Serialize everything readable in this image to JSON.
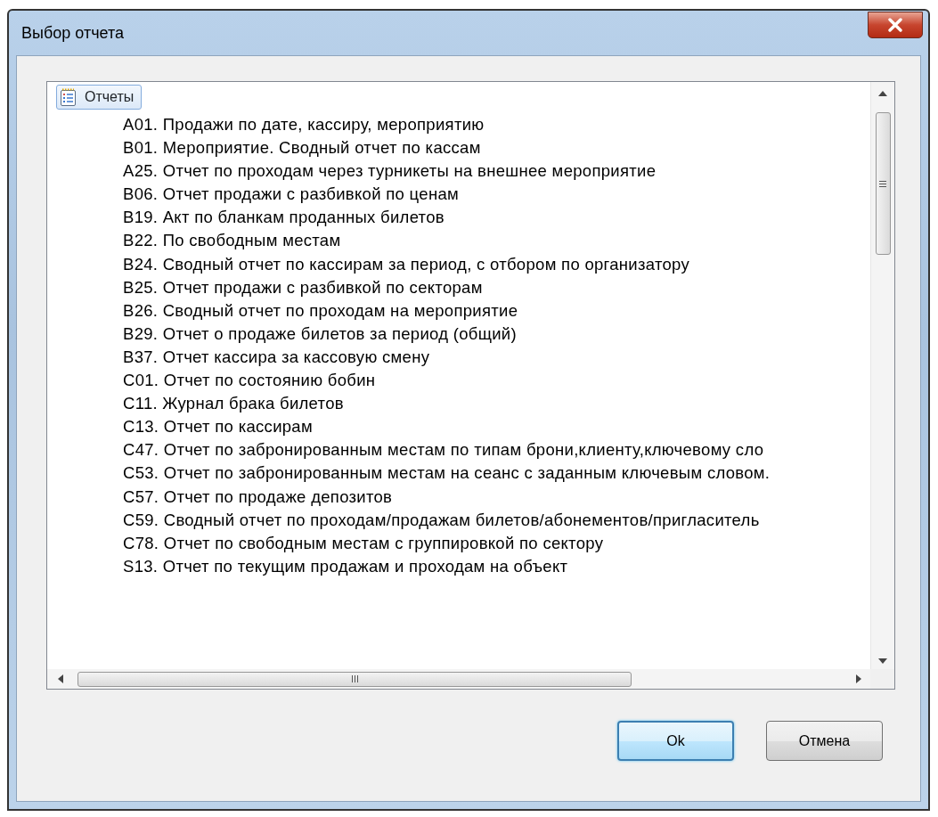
{
  "window": {
    "title": "Выбор отчета"
  },
  "tree": {
    "root": {
      "label": "Отчеты",
      "selected": true,
      "children": [
        {
          "label": "A01. Продажи по дате, кассиру, мероприятию",
          "selected": false
        },
        {
          "label": "B01. Мероприятие. Сводный отчет по кассам",
          "selected": false
        },
        {
          "label": "A25. Отчет по проходам через турникеты на внешнее мероприятие",
          "selected": false
        },
        {
          "label": "B06. Отчет продажи с разбивкой по ценам",
          "selected": false
        },
        {
          "label": "B19. Акт по бланкам проданных билетов",
          "selected": false
        },
        {
          "label": "B22. По свободным местам",
          "selected": false
        },
        {
          "label": "B24. Сводный отчет по кассирам за период, с отбором по организатору",
          "selected": false
        },
        {
          "label": "B25. Отчет продажи с разбивкой по секторам",
          "selected": false
        },
        {
          "label": "B26. Сводный отчет по проходам на мероприятие",
          "selected": false
        },
        {
          "label": "B29. Отчет о продаже билетов за период (общий)",
          "selected": false
        },
        {
          "label": "B37. Отчет кассира за кассовую смену",
          "selected": false
        },
        {
          "label": "C01. Отчет по состоянию бобин",
          "selected": false
        },
        {
          "label": "C11. Журнал брака билетов",
          "selected": false
        },
        {
          "label": "C13. Отчет по кассирам",
          "selected": false
        },
        {
          "label": "C47. Отчет по забронированным местам по типам брони,клиенту,ключевому сло",
          "selected": false
        },
        {
          "label": "C53. Отчет по забронированным местам на сеанс с заданным ключевым словом.",
          "selected": false
        },
        {
          "label": "C57. Отчет по продаже депозитов",
          "selected": false
        },
        {
          "label": "C59. Сводный отчет по проходам/продажам билетов/абонементов/пригласитель",
          "selected": false
        },
        {
          "label": "C78. Отчет по свободным местам с группировкой по сектору",
          "selected": false
        },
        {
          "label": "S13. Отчет по текущим продажам и проходам на объект",
          "selected": false
        }
      ]
    }
  },
  "buttons": [
    {
      "label": "Ok",
      "default": true
    },
    {
      "label": "Отмена",
      "default": false
    }
  ]
}
